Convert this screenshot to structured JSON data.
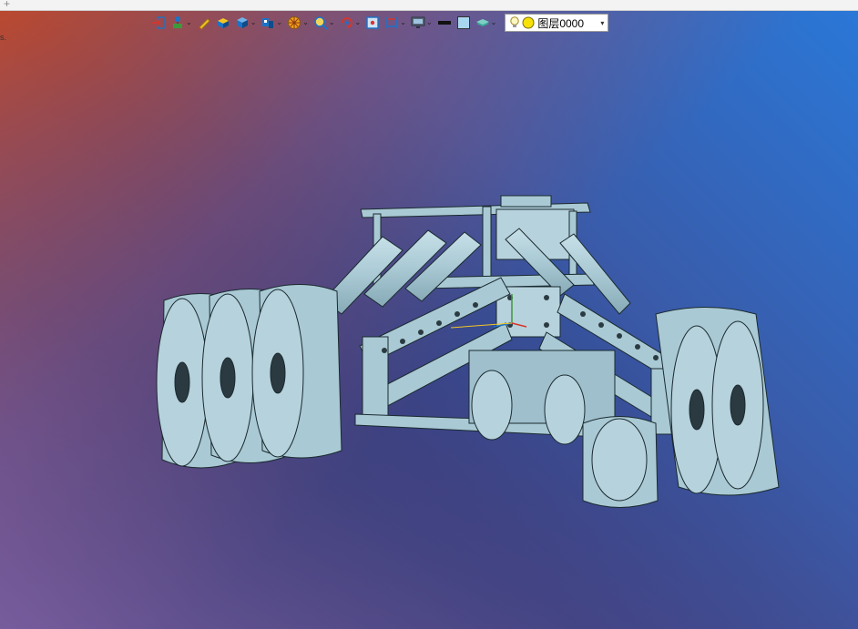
{
  "window": {
    "corner_glyph": "+",
    "left_mark": "s."
  },
  "toolbar": {
    "buttons": [
      {
        "name": "insert-icon",
        "caret": false
      },
      {
        "name": "scene-tree-icon",
        "caret": true
      },
      {
        "name": "pencil-icon",
        "caret": false
      },
      {
        "name": "solid-box-icon",
        "caret": false
      },
      {
        "name": "cube-icon",
        "caret": true
      },
      {
        "name": "view-cube-icon",
        "caret": true
      },
      {
        "name": "render-style-icon",
        "caret": true
      },
      {
        "name": "zoom-icon",
        "caret": true
      },
      {
        "name": "rotate-icon",
        "caret": true
      },
      {
        "name": "frame-icon",
        "caret": false
      },
      {
        "name": "dimension-icon",
        "caret": true
      },
      {
        "name": "display-icon",
        "caret": true
      },
      {
        "name": "line-color-icon",
        "caret": false
      },
      {
        "name": "fill-color-icon",
        "caret": false
      },
      {
        "name": "layer-stack-icon",
        "caret": true
      }
    ],
    "caret_glyph": "⌄",
    "layer": {
      "label": "图层0000",
      "dropdown_glyph": "▾"
    }
  },
  "colors": {
    "part_fill": "#a9c9d4",
    "part_stroke": "#1b2a30",
    "accent_blue": "#1a73c8",
    "accent_yellow": "#f3c623",
    "accent_red": "#d8352b",
    "accent_green": "#3a9a3a"
  }
}
